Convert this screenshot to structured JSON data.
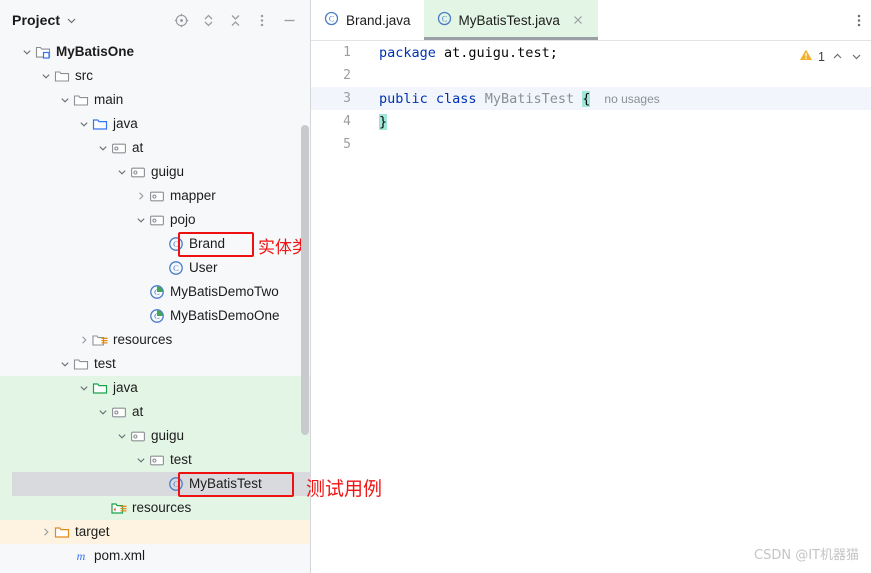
{
  "panel": {
    "title": "Project",
    "title_chevron_icon": "chevron-down-icon",
    "toolbar": [
      {
        "name": "select-opened-file-icon",
        "label": "Select Opened File"
      },
      {
        "name": "expand-all-icon",
        "label": "Expand All"
      },
      {
        "name": "collapse-all-icon",
        "label": "Collapse All"
      },
      {
        "name": "more-options-icon",
        "label": "More Options"
      },
      {
        "name": "hide-panel-icon",
        "label": "Hide"
      }
    ]
  },
  "tree": [
    {
      "label": "MyBatisOne",
      "indent": 0,
      "arrow": "down",
      "icon": "module-icon",
      "bold": true,
      "bg": "none"
    },
    {
      "label": "src",
      "indent": 1,
      "arrow": "down",
      "icon": "folder-icon",
      "bold": false,
      "bg": "none"
    },
    {
      "label": "main",
      "indent": 2,
      "arrow": "down",
      "icon": "folder-icon",
      "bold": false,
      "bg": "none"
    },
    {
      "label": "java",
      "indent": 3,
      "arrow": "down",
      "icon": "source-folder-icon",
      "bold": false,
      "bg": "none"
    },
    {
      "label": "at",
      "indent": 4,
      "arrow": "down",
      "icon": "package-icon",
      "bold": false,
      "bg": "none"
    },
    {
      "label": "guigu",
      "indent": 5,
      "arrow": "down",
      "icon": "package-icon",
      "bold": false,
      "bg": "none"
    },
    {
      "label": "mapper",
      "indent": 6,
      "arrow": "right",
      "icon": "package-icon",
      "bold": false,
      "bg": "none"
    },
    {
      "label": "pojo",
      "indent": 6,
      "arrow": "down",
      "icon": "package-icon",
      "bold": false,
      "bg": "none"
    },
    {
      "label": "Brand",
      "indent": 7,
      "arrow": "none",
      "icon": "java-class-icon",
      "bold": false,
      "bg": "none"
    },
    {
      "label": "User",
      "indent": 7,
      "arrow": "none",
      "icon": "java-class-icon",
      "bold": false,
      "bg": "none"
    },
    {
      "label": "MyBatisDemoTwo",
      "indent": 6,
      "arrow": "none",
      "icon": "runnable-class-icon",
      "bold": false,
      "bg": "none"
    },
    {
      "label": "MyBatisDemoOne",
      "indent": 6,
      "arrow": "none",
      "icon": "runnable-class-icon",
      "bold": false,
      "bg": "none"
    },
    {
      "label": "resources",
      "indent": 3,
      "arrow": "right",
      "icon": "resources-folder-icon",
      "bold": false,
      "bg": "none"
    },
    {
      "label": "test",
      "indent": 2,
      "arrow": "down",
      "icon": "folder-icon",
      "bold": false,
      "bg": "none"
    },
    {
      "label": "java",
      "indent": 3,
      "arrow": "down",
      "icon": "test-source-folder-icon",
      "bold": false,
      "bg": "green"
    },
    {
      "label": "at",
      "indent": 4,
      "arrow": "down",
      "icon": "package-icon",
      "bold": false,
      "bg": "green"
    },
    {
      "label": "guigu",
      "indent": 5,
      "arrow": "down",
      "icon": "package-icon",
      "bold": false,
      "bg": "green"
    },
    {
      "label": "test",
      "indent": 6,
      "arrow": "down",
      "icon": "package-icon",
      "bold": false,
      "bg": "green"
    },
    {
      "label": "MyBatisTest",
      "indent": 7,
      "arrow": "none",
      "icon": "java-class-icon",
      "bold": false,
      "bg": "green",
      "selected": true
    },
    {
      "label": "resources",
      "indent": 4,
      "arrow": "none",
      "icon": "test-resources-folder-icon",
      "bold": false,
      "bg": "green"
    },
    {
      "label": "target",
      "indent": 1,
      "arrow": "right",
      "icon": "excluded-folder-icon",
      "bold": false,
      "bg": "cream"
    },
    {
      "label": "pom.xml",
      "indent": 2,
      "arrow": "none",
      "icon": "maven-file-icon",
      "bold": false,
      "bg": "none"
    }
  ],
  "annotations": [
    {
      "name": "annotation-brand",
      "text": "实体类Brand-"
    },
    {
      "name": "annotation-test-case",
      "text": "测试用例"
    }
  ],
  "editor": {
    "tabs": [
      {
        "label": "Brand.java",
        "icon": "java-class-icon",
        "active": false,
        "closable": false
      },
      {
        "label": "MyBatisTest.java",
        "icon": "java-class-icon",
        "active": true,
        "closable": true
      }
    ],
    "tab_more_icon": "more-options-icon",
    "close_icon": "close-icon",
    "inspection": {
      "warning_icon": "warning-triangle-icon",
      "warning_count": "1",
      "prev_icon": "chevron-up-icon",
      "next_icon": "chevron-down-icon"
    },
    "lines": [
      {
        "num": "1",
        "highlight": false
      },
      {
        "num": "2",
        "highlight": false
      },
      {
        "num": "3",
        "highlight": true
      },
      {
        "num": "4",
        "highlight": false
      },
      {
        "num": "5",
        "highlight": false
      }
    ],
    "code": {
      "l1_kw": "package",
      "l1_rest": " at.guigu.test;",
      "l3_kw1": "public",
      "l3_kw2": "class",
      "l3_name": "MyBatisTest",
      "l3_brace": "{",
      "l3_hint": "no usages",
      "l4_brace": "}"
    }
  },
  "watermark": "CSDN @IT机器猫",
  "colors": {
    "keyword": "#0033B3",
    "brace_highlight": "#9FE8D8",
    "test_source_bg": "#E3F5E4",
    "excluded_bg": "#FDF3E0",
    "annotation_red": "#F01515",
    "selection_gray": "#D9DADE"
  }
}
